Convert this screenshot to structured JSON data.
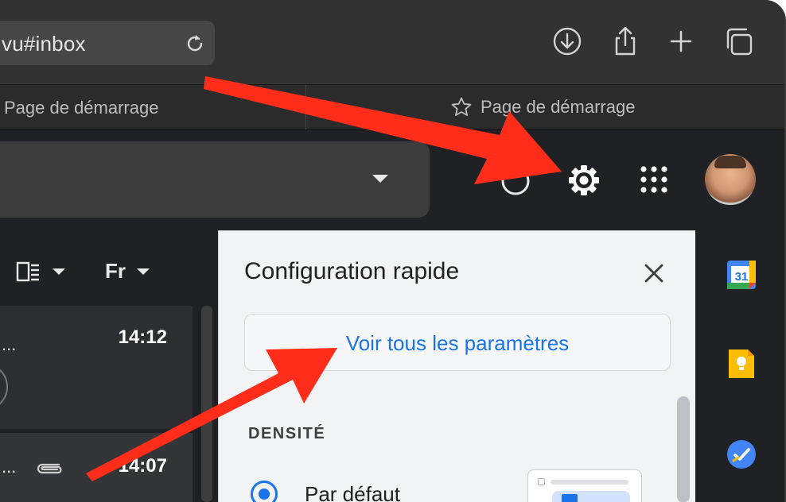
{
  "browser": {
    "url_text": "vu#inbox",
    "icons": [
      "reload-icon",
      "download-icon",
      "share-icon",
      "new-tab-plus-icon",
      "tabs-overview-icon"
    ]
  },
  "favorites": {
    "left_item": "Page de démarrage",
    "right_item": "Page de démarrage",
    "right_icon": "star-icon"
  },
  "gmail_header": {
    "icons": [
      "search-options-caret-icon",
      "help-icon",
      "gear-icon",
      "apps-grid-icon",
      "avatar"
    ]
  },
  "mail_list": {
    "tools": [
      {
        "icon": "split-pane-icon"
      },
      {
        "label": "Fr"
      }
    ],
    "rows": [
      {
        "snippet": "...",
        "time": "14:12"
      },
      {
        "snippet": "...",
        "time": "14:07",
        "has_attachment": true
      }
    ]
  },
  "quick_settings": {
    "title": "Configuration rapide",
    "all_settings_link": "Voir tous les paramètres",
    "density_heading": "DENSITÉ",
    "density_options": [
      {
        "label": "Par défaut",
        "selected": true
      }
    ]
  },
  "side_rail": {
    "icons": [
      "calendar-icon",
      "keep-icon",
      "tasks-icon"
    ],
    "calendar_day": "31"
  },
  "colors": {
    "accent": "#1a73e8",
    "arrow": "#ff2d1a",
    "chrome_dark": "#323232",
    "gmail_bg": "#202124",
    "panel_bg": "#f1f3f4"
  }
}
